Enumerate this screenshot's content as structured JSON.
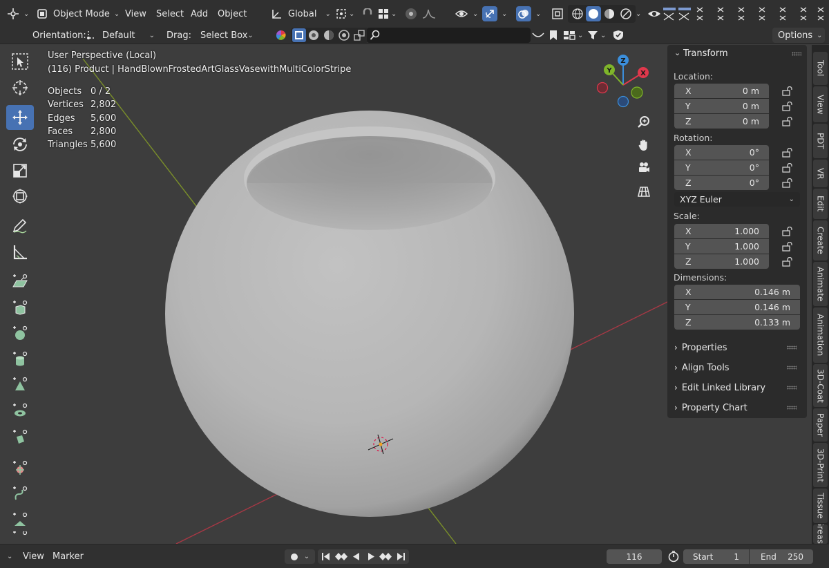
{
  "header": {
    "mode_label": "Object Mode",
    "menu": [
      "View",
      "Select",
      "Add",
      "Object"
    ],
    "transform_orientation": "Global",
    "orientation_label": "Orientation:",
    "orientation_value": "Default",
    "drag_label": "Drag:",
    "drag_value": "Select Box",
    "options_label": "Options",
    "search_placeholder": ""
  },
  "overlay": {
    "view_name": "User Perspective (Local)",
    "object_line": "(116) Product | HandBlownFrostedArtGlassVasewithMultiColorStripe",
    "stats": [
      {
        "label": "Objects",
        "value": "0 / 2"
      },
      {
        "label": "Vertices",
        "value": "2,802"
      },
      {
        "label": "Edges",
        "value": "5,600"
      },
      {
        "label": "Faces",
        "value": "2,800"
      },
      {
        "label": "Triangles",
        "value": "5,600"
      }
    ]
  },
  "gizmo": {
    "x": "X",
    "y": "Y",
    "z": "Z",
    "colors": {
      "x": "#e0384c",
      "y": "#7fb52a",
      "z": "#3b8fdc"
    }
  },
  "panel": {
    "title": "Transform",
    "location_label": "Location:",
    "location": [
      {
        "axis": "X",
        "value": "0 m"
      },
      {
        "axis": "Y",
        "value": "0 m"
      },
      {
        "axis": "Z",
        "value": "0 m"
      }
    ],
    "rotation_label": "Rotation:",
    "rotation": [
      {
        "axis": "X",
        "value": "0°"
      },
      {
        "axis": "Y",
        "value": "0°"
      },
      {
        "axis": "Z",
        "value": "0°"
      }
    ],
    "rotation_mode": "XYZ Euler",
    "scale_label": "Scale:",
    "scale": [
      {
        "axis": "X",
        "value": "1.000"
      },
      {
        "axis": "Y",
        "value": "1.000"
      },
      {
        "axis": "Z",
        "value": "1.000"
      }
    ],
    "dimensions_label": "Dimensions:",
    "dimensions": [
      {
        "axis": "X",
        "value": "0.146 m"
      },
      {
        "axis": "Y",
        "value": "0.146 m"
      },
      {
        "axis": "Z",
        "value": "0.133 m"
      }
    ],
    "subpanels": [
      "Properties",
      "Align Tools",
      "Edit Linked Library",
      "Property Chart"
    ]
  },
  "tabs": [
    "Tool",
    "View",
    "PDT",
    "VR",
    "Edit",
    "Create",
    "Animate",
    "Animation",
    "3D-Coat",
    "Paper",
    "3D-Print",
    "Tissue",
    "Grease"
  ],
  "timeline": {
    "menu": [
      "View",
      "Marker"
    ],
    "current_frame": "116",
    "start_label": "Start",
    "start_value": "1",
    "end_label": "End",
    "end_value": "250"
  },
  "colors": {
    "accent": "#4772b3",
    "background": "#3d3d3d",
    "header": "#303030"
  }
}
